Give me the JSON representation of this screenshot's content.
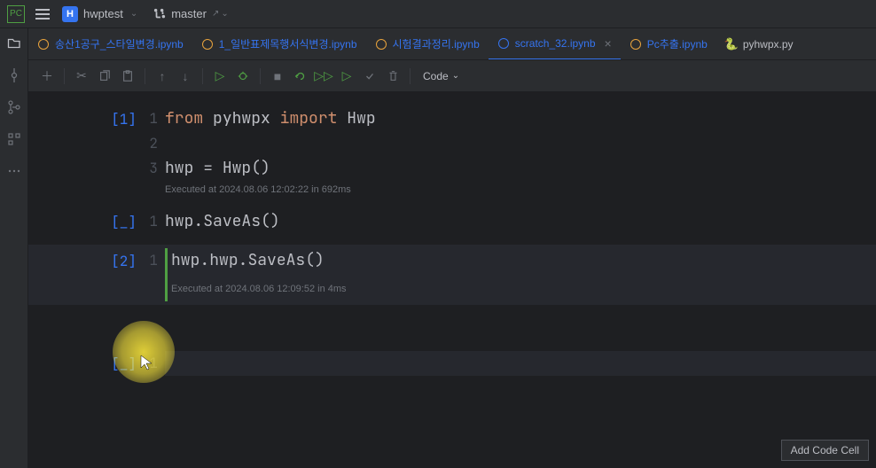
{
  "header": {
    "project": "hwptest",
    "branch": "master"
  },
  "tabs": [
    {
      "name": "송산1공구_스타일변경.ipynb",
      "type": "jupyter"
    },
    {
      "name": "1_일반표제목행서식변경.ipynb",
      "type": "jupyter"
    },
    {
      "name": "시험결과정리.ipynb",
      "type": "jupyter"
    },
    {
      "name": "scratch_32.ipynb",
      "type": "jupyter-active",
      "active": true
    },
    {
      "name": "Pc추출.ipynb",
      "type": "jupyter"
    },
    {
      "name": "pyhwpx.py",
      "type": "python"
    }
  ],
  "toolbar": {
    "code_label": "Code"
  },
  "cells": [
    {
      "label": "[1]",
      "lines": [
        "from pyhwpx import Hwp",
        "",
        "hwp = Hwp()"
      ],
      "exec_info": "Executed at 2024.08.06 12:02:22 in 692ms"
    },
    {
      "label": "[_]",
      "lines": [
        "hwp.SaveAs()"
      ]
    },
    {
      "label": "[2]",
      "lines": [
        "hwp.hwp.SaveAs()"
      ],
      "exec_info": "Executed at 2024.08.06 12:09:52 in 4ms",
      "selected": true
    },
    {
      "label": "[_]",
      "lines": [
        ""
      ]
    }
  ],
  "add_cell_label": "Add Code Cell"
}
